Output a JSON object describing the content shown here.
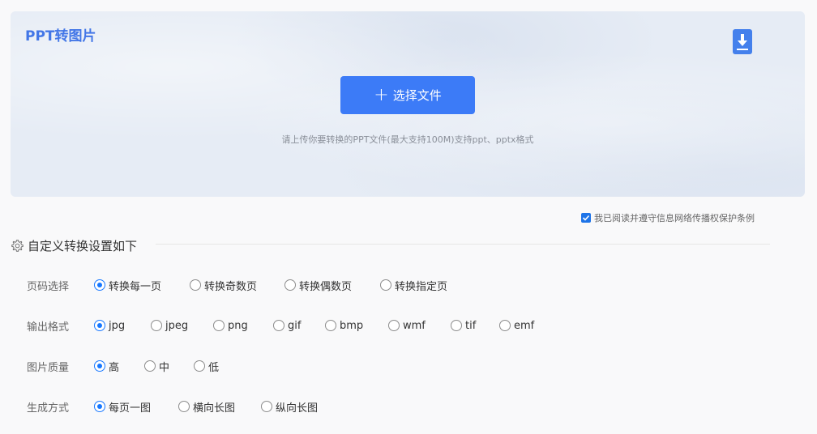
{
  "upload": {
    "title": "PPT转图片",
    "select_button": "选择文件",
    "hint": "请上传你要转换的PPT文件(最大支持100M)支持ppt、pptx格式"
  },
  "agreement": {
    "label": "我已阅读并遵守信息网络传播权保护条例",
    "checked": true
  },
  "settings": {
    "title": "自定义转换设置如下",
    "rows": [
      {
        "label": "页码选择",
        "options": [
          "转换每一页",
          "转换奇数页",
          "转换偶数页",
          "转换指定页"
        ],
        "selected": 0
      },
      {
        "label": "输出格式",
        "options": [
          "jpg",
          "jpeg",
          "png",
          "gif",
          "bmp",
          "wmf",
          "tif",
          "emf"
        ],
        "selected": 0
      },
      {
        "label": "图片质量",
        "options": [
          "高",
          "中",
          "低"
        ],
        "selected": 0
      },
      {
        "label": "生成方式",
        "options": [
          "每页一图",
          "横向长图",
          "纵向长图"
        ],
        "selected": 0
      }
    ]
  },
  "colors": {
    "accent": "#3c7bf7",
    "title": "#4276e7"
  },
  "icons": {
    "download": "download-icon",
    "settings": "gear-icon",
    "plus": "plus-icon"
  }
}
